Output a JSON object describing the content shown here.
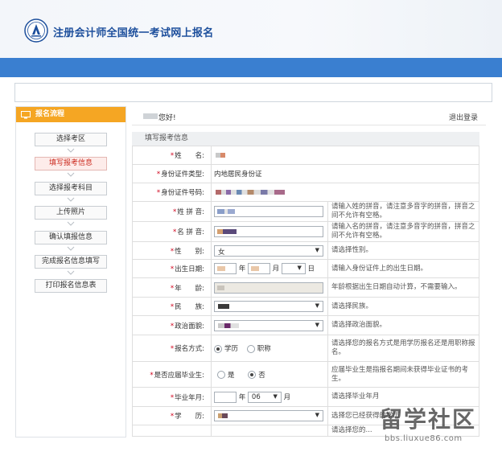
{
  "header": {
    "title": "注册会计师全国统一考试网上报名"
  },
  "sidebar": {
    "heading": "报名流程",
    "steps": [
      "选择考区",
      "填写报考信息",
      "选择报考科目",
      "上传照片",
      "确认填报信息",
      "完成报名信息填写",
      "打印报名信息表"
    ],
    "active_index": 1
  },
  "main": {
    "greeting": "您好!",
    "logout": "退出登录",
    "section_title": "填写报考信息",
    "rows": [
      {
        "label": "姓　　名:",
        "value": "",
        "hint": ""
      },
      {
        "label": "身份证件类型:",
        "value": "内地居民身份证",
        "hint": ""
      },
      {
        "label": "身份证件号码:",
        "value": "",
        "hint": ""
      },
      {
        "label": "姓 拼 音:",
        "value": "",
        "hint": "请输入姓的拼音，请注意多音字的拼音，拼音之间不允许有空格。"
      },
      {
        "label": "名 拼 音:",
        "value": "",
        "hint": "请输入名的拼音，请注意多音字的拼音，拼音之间不允许有空格。"
      },
      {
        "label": "性　　别:",
        "value": "女",
        "hint": "请选择性别。"
      },
      {
        "label": "出生日期:",
        "value": "",
        "hint": "请输入身份证件上的出生日期。"
      },
      {
        "label": "年　　龄:",
        "value": "",
        "hint": "年龄根据出生日期自动计算，不需要输入。"
      },
      {
        "label": "民　　族:",
        "value": "",
        "hint": "请选择民族。"
      },
      {
        "label": "政治面貌:",
        "value": "",
        "hint": "请选择政治面貌。"
      },
      {
        "label": "报名方式:",
        "value": "",
        "hint": "请选择您的报名方式是用学历报名还是用职称报名。"
      },
      {
        "label": "是否应届毕业生:",
        "value": "",
        "hint": "应届毕业生是指报名期间未获得毕业证书的考生。"
      },
      {
        "label": "毕业年月:",
        "value": "",
        "hint": "请选择毕业年月"
      },
      {
        "label": "学　　历:",
        "value": "",
        "hint": "选择您已经获得的学历"
      },
      {
        "label": "",
        "value": "",
        "hint": "请选择您的..."
      }
    ],
    "date_units": {
      "year": "年",
      "month": "月",
      "day": "日"
    },
    "radio_baoming": {
      "a": "学历",
      "b": "职称"
    },
    "radio_yingjie": {
      "a": "是",
      "b": "否"
    },
    "grad_month": "06"
  },
  "watermark": {
    "text": "留学社区",
    "url": "bbs.liuxue86.com"
  },
  "colors": {
    "accent": "#3a7fd0",
    "sidebar_head": "#f5a623",
    "required": "#d0021b",
    "active_step": "#cc2a1f"
  },
  "icons": [
    "logo-emblem-icon",
    "monitor-icon",
    "chevron-down-icon"
  ]
}
